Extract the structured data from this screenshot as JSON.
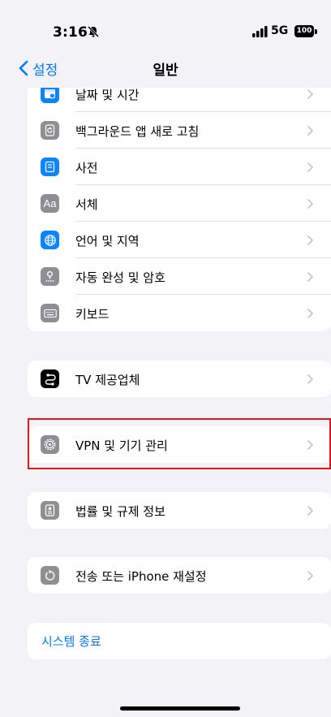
{
  "status_bar": {
    "time": "3:16",
    "network": "5G",
    "battery": "100"
  },
  "nav": {
    "back_label": "설정",
    "title": "일반"
  },
  "groups": [
    {
      "items": [
        {
          "label": "날짜 및 시간",
          "icon": "calendar-clock-icon"
        },
        {
          "label": "백그라운드 앱 새로 고침",
          "icon": "refresh-icon"
        },
        {
          "label": "사전",
          "icon": "dictionary-icon"
        },
        {
          "label": "서체",
          "icon": "font-icon",
          "icon_text": "Aa"
        },
        {
          "label": "언어 및 지역",
          "icon": "globe-icon"
        },
        {
          "label": "자동 완성 및 암호",
          "icon": "key-icon"
        },
        {
          "label": "키보드",
          "icon": "keyboard-icon"
        }
      ]
    },
    {
      "items": [
        {
          "label": "TV 제공업체",
          "icon": "tv-provider-icon"
        }
      ]
    },
    {
      "items": [
        {
          "label": "VPN 및 기기 관리",
          "icon": "gear-icon"
        }
      ]
    },
    {
      "items": [
        {
          "label": "법률 및 규제 정보",
          "icon": "document-icon"
        }
      ]
    },
    {
      "items": [
        {
          "label": "전송 또는 iPhone 재설정",
          "icon": "reset-icon"
        }
      ]
    }
  ],
  "shutdown_label": "시스템 종료",
  "colors": {
    "accent": "#007aff",
    "background": "#f2f2f7",
    "icon_gray": "#8e8e93",
    "icon_blue": "#0a84ff",
    "highlight": "#e0191e"
  }
}
